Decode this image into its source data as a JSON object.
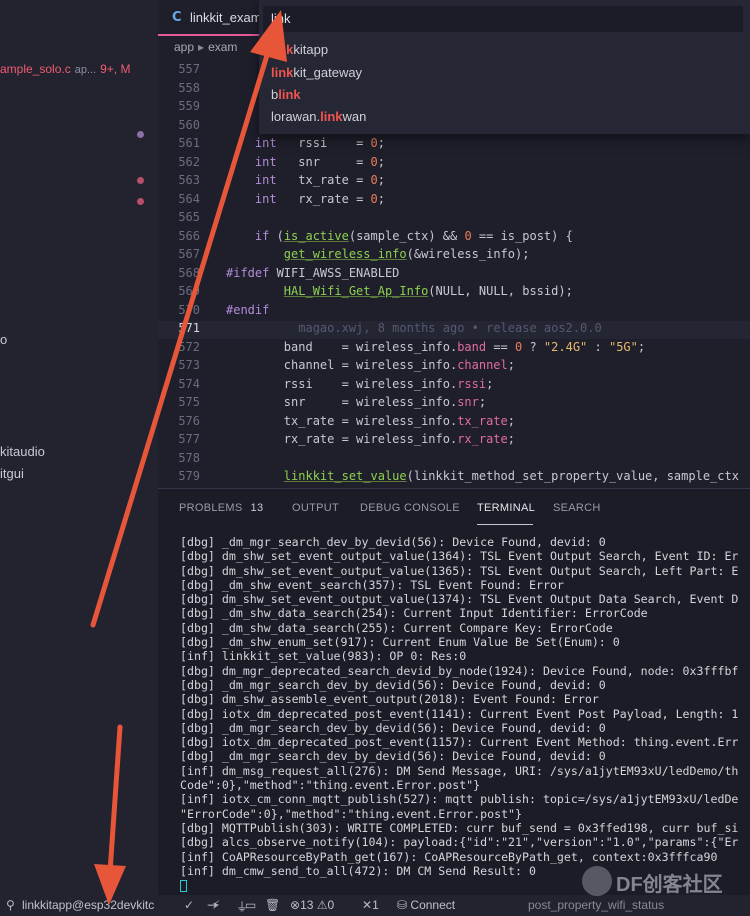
{
  "sidebar": {
    "file": {
      "name": "ample_solo.c",
      "dir": "ap...",
      "badge": "9+, M"
    },
    "items": [
      {
        "label": "o"
      },
      {
        "label": "kitaudio"
      },
      {
        "label": "itgui"
      }
    ]
  },
  "editor": {
    "tab": {
      "icon": "C",
      "label": "linkkit_exam"
    },
    "breadcrumbs": [
      "app",
      "exam"
    ],
    "blame": "magao.xwj, 8 months ago • release aos2.0.0"
  },
  "quickopen": {
    "query": "link",
    "results": [
      {
        "pre": "",
        "match": "link",
        "post": "kitapp"
      },
      {
        "pre": "",
        "match": "link",
        "post": "kit_gateway"
      },
      {
        "pre": "b",
        "match": "link",
        "post": ""
      },
      {
        "pre": "lorawan.",
        "match": "link",
        "post": "wan"
      }
    ]
  },
  "panel": {
    "tabs": {
      "problems": "PROBLEMS",
      "problems_count": "13",
      "output": "OUTPUT",
      "debug": "DEBUG CONSOLE",
      "terminal": "TERMINAL",
      "search": "SEARCH"
    },
    "terminal_lines": [
      "[dbg] _dm_mgr_search_dev_by_devid(56): Device Found, devid: 0",
      "[dbg] dm_shw_set_event_output_value(1364): TSL Event Output Search, Event ID: Er",
      "[dbg] dm_shw_set_event_output_value(1365): TSL Event Output Search, Left Part: E",
      "[dbg] _dm_shw_event_search(357): TSL Event Found: Error",
      "[dbg] dm_shw_set_event_output_value(1374): TSL Event Output Data Search, Event D",
      "[dbg] _dm_shw_data_search(254): Current Input Identifier: ErrorCode",
      "[dbg] _dm_shw_data_search(255): Current Compare Key: ErrorCode",
      "[dbg] _dm_shw_enum_set(917): Current Enum Value Be Set(Enum): 0",
      "[inf] linkkit_set_value(983): OP 0: Res:0",
      "[dbg] dm_mgr_deprecated_search_devid_by_node(1924): Device Found, node: 0x3fffbf",
      "[dbg] _dm_mgr_search_dev_by_devid(56): Device Found, devid: 0",
      "[dbg] dm_shw_assemble_event_output(2018): Event Found: Error",
      "[dbg] iotx_dm_deprecated_post_event(1141): Current Event Post Payload, Length: 1",
      "[dbg] _dm_mgr_search_dev_by_devid(56): Device Found, devid: 0",
      "[dbg] iotx_dm_deprecated_post_event(1157): Current Event Method: thing.event.Err",
      "[dbg] _dm_mgr_search_dev_by_devid(56): Device Found, devid: 0",
      "[inf] dm_msg_request_all(276): DM Send Message, URI: /sys/a1jytEM93xU/ledDemo/th",
      "Code\":0},\"method\":\"thing.event.Error.post\"}",
      "[inf] iotx_cm_conn_mqtt_publish(527): mqtt publish: topic=/sys/a1jytEM93xU/ledDe",
      "\"ErrorCode\":0},\"method\":\"thing.event.Error.post\"}",
      "[dbg] MQTTPublish(303): WRITE COMPLETED: curr buf_send = 0x3ffed198, curr buf_si",
      "[dbg] alcs_observe_notify(104): payload:{\"id\":\"21\",\"version\":\"1.0\",\"params\":{\"Er",
      "[inf] CoAPResourceByPath_get(167): CoAPResourceByPath_get, context:0x3fffca90",
      "[inf] dm_cmw_send_to_all(472): DM CM Send Result: 0"
    ]
  },
  "statusbar": {
    "target": "linkkitapp@esp32devkitc",
    "errors": "13",
    "warnings": "0",
    "tasks": "1",
    "connect": "Connect",
    "right": "post_property_wifi_status"
  },
  "watermark": {
    "text": "DF创客社区"
  },
  "colors": {
    "accent_pink": "#e85a9b",
    "match_red": "#f0544f",
    "arrow": "#e8563a",
    "string": "#e6b96a",
    "number": "#ea7d5c",
    "function": "#8fd14f",
    "keyword": "#b38cd8"
  }
}
